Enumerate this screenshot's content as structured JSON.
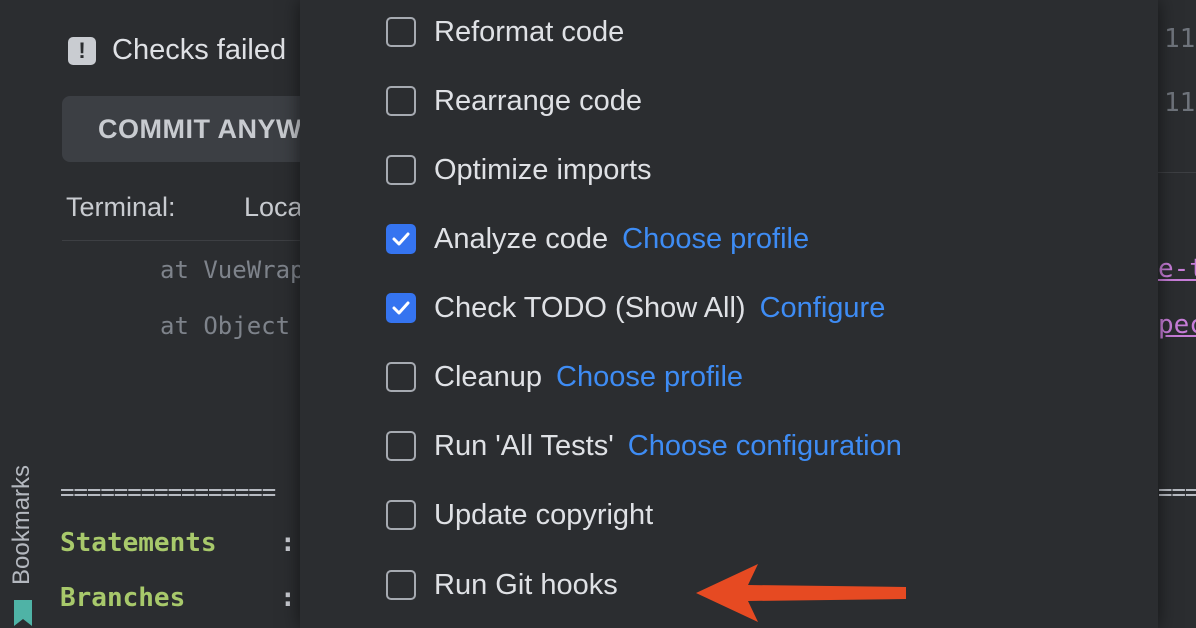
{
  "sidebar": {
    "label": "Bookmarks"
  },
  "commit_panel": {
    "checks_text": "Checks failed",
    "commit_button": "COMMIT ANYWAY",
    "terminal_label": "Terminal:",
    "terminal_tab": "Local"
  },
  "console": {
    "trace_lines": [
      "at VueWrapper",
      "at Object"
    ],
    "separator": "================",
    "stats": [
      {
        "label": "Statements",
        "sep": ":"
      },
      {
        "label": "Branches",
        "sep": ":"
      }
    ]
  },
  "right_editor": {
    "numbers": [
      "11",
      "11"
    ],
    "links": [
      "e-t",
      "pec"
    ],
    "separator": "===="
  },
  "checkin_options": [
    {
      "label": "Reformat code",
      "checked": false,
      "link": ""
    },
    {
      "label": "Rearrange code",
      "checked": false,
      "link": ""
    },
    {
      "label": "Optimize imports",
      "checked": false,
      "link": ""
    },
    {
      "label": "Analyze code",
      "checked": true,
      "link": "Choose profile"
    },
    {
      "label": "Check TODO (Show All)",
      "checked": true,
      "link": "Configure"
    },
    {
      "label": "Cleanup",
      "checked": false,
      "link": "Choose profile"
    },
    {
      "label": "Run 'All Tests'",
      "checked": false,
      "link": "Choose configuration"
    },
    {
      "label": "Update copyright",
      "checked": false,
      "link": ""
    },
    {
      "label": "Run Git hooks",
      "checked": false,
      "link": ""
    }
  ],
  "colors": {
    "background": "#2b2d30",
    "accent": "#3574f0",
    "link": "#3e8cf4",
    "arrow": "#e64a22",
    "stat_green": "#a8c96b"
  },
  "icons": [
    "warning-icon",
    "bookmark-icon",
    "checkmark-icon",
    "red-arrow-icon"
  ]
}
